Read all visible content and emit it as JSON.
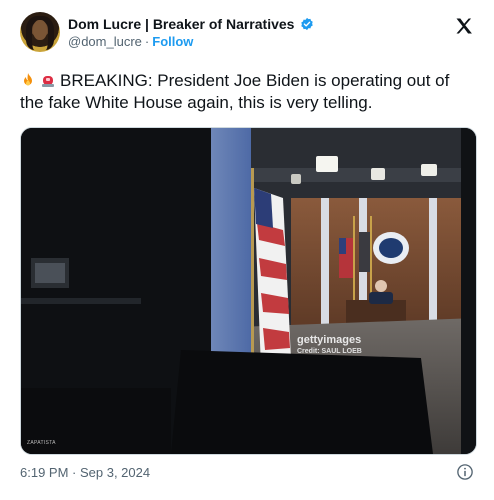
{
  "author": {
    "display_name": "Dom Lucre | Breaker of Narratives",
    "handle": "@dom_lucre",
    "separator": "·",
    "follow_label": "Follow",
    "verified_color": "#1d9bf0"
  },
  "tweet": {
    "emojis": [
      "fire-emoji",
      "siren-emoji"
    ],
    "text": "BREAKING: President Joe Biden is operating out of the fake White House again, this is very telling."
  },
  "media": {
    "watermark": "gettyimages",
    "credit": "Credit: SAUL LOEB",
    "corner_tag": "ZAPATISTA"
  },
  "footer": {
    "timestamp": "6:19 PM · Sep 3, 2024"
  },
  "icons": {
    "logo": "x-logo-icon",
    "info": "info-icon"
  },
  "colors": {
    "link": "#1d9bf0",
    "muted": "#536471",
    "text": "#0f1419"
  }
}
